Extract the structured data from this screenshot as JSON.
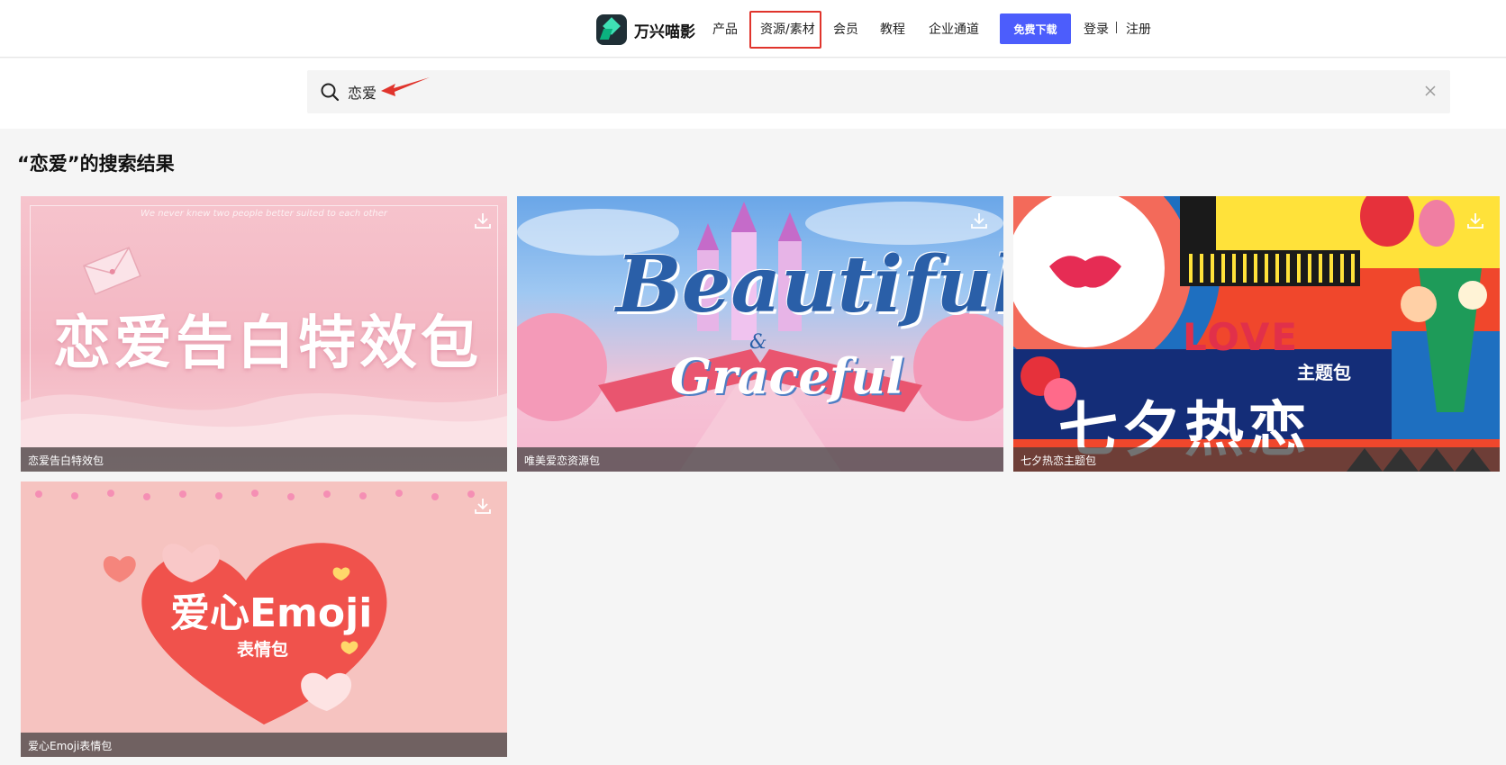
{
  "brand": {
    "name": "万兴喵影"
  },
  "nav": {
    "products": "产品",
    "resources": "资源/素材",
    "membership": "会员",
    "tutorials": "教程",
    "enterprise": "企业通道",
    "download": "免费下载",
    "login": "登录",
    "register": "注册"
  },
  "search": {
    "value": "恋爱"
  },
  "results": {
    "title": "“恋爱”的搜索结果"
  },
  "cards": [
    {
      "caption": "恋爱告白特效包",
      "headline": "恋爱告白特效包",
      "tagline": "We never knew two people better suited to each other"
    },
    {
      "caption": "唯美爱恋资源包",
      "headline": "Beautiful",
      "amp": "&",
      "subline": "Graceful"
    },
    {
      "caption": "七夕热恋主题包",
      "love": "LOVE",
      "theme": "主题包",
      "headline": "七夕热恋"
    },
    {
      "caption": "爱心Emoji表情包",
      "headline": "爱心Emoji",
      "subline": "表情包"
    }
  ],
  "colors": {
    "accent": "#4c5dfc",
    "highlight": "#e0342c"
  },
  "icons": [
    "logo-icon",
    "search-icon",
    "clear-icon",
    "download-icon"
  ]
}
